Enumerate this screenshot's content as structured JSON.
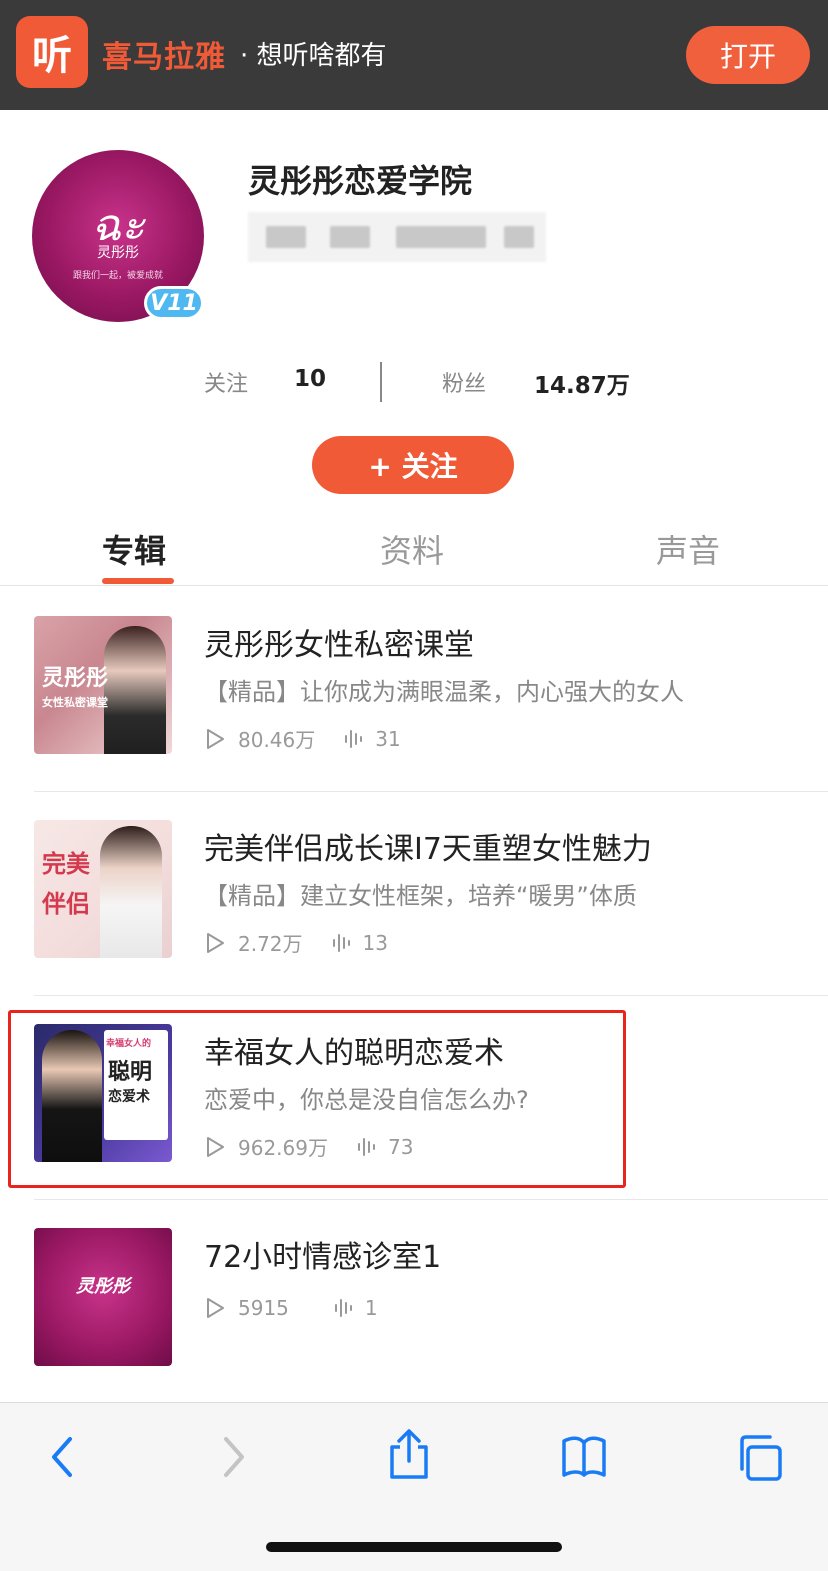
{
  "banner": {
    "app_icon_glyph": "听",
    "brand": "喜马拉雅",
    "slogan": "· 想听啥都有",
    "open_label": "打开"
  },
  "profile": {
    "avatar_logo": "ฉะ",
    "avatar_name": "灵彤彤",
    "avatar_sub": "跟我们一起，被爱成就",
    "level_badge": "V11",
    "name": "灵彤彤恋爱学院",
    "following_label": "关注",
    "following_count": "10",
    "fans_label": "粉丝",
    "fans_count": "14.87万",
    "follow_button": "+ 关注"
  },
  "tabs": [
    {
      "label": "专辑",
      "active": true
    },
    {
      "label": "资料",
      "active": false
    },
    {
      "label": "声音",
      "active": false
    }
  ],
  "albums": [
    {
      "title": "灵彤彤女性私密课堂",
      "subtitle": "【精品】让你成为满眼温柔，内心强大的女人",
      "plays": "80.46万",
      "tracks": "31",
      "thumb_text_1": "灵彤彤",
      "thumb_text_2": "女性私密课堂"
    },
    {
      "title": "完美伴侣成长课I7天重塑女性魅力",
      "subtitle": "【精品】建立女性框架，培养“暖男”体质",
      "plays": "2.72万",
      "tracks": "13",
      "thumb_text_1": "完美",
      "thumb_text_2": "伴侣"
    },
    {
      "title": "幸福女人的聪明恋爱术",
      "subtitle": "恋爱中，你总是没自信怎么办?",
      "plays": "962.69万",
      "tracks": "73",
      "thumb_text_1": "幸福女人的",
      "thumb_text_2": "聪明",
      "thumb_text_3": "恋爱术"
    },
    {
      "title": "72小时情感诊室1",
      "subtitle": "",
      "plays": "5915",
      "tracks": "1",
      "thumb_text_1": "灵彤彤"
    }
  ],
  "colors": {
    "accent": "#f05a37",
    "banner_bg": "#3a3a3a",
    "highlight": "#e8241c",
    "badge": "#4fb8f0"
  },
  "icons": [
    "back-icon",
    "forward-icon",
    "share-icon",
    "bookmarks-icon",
    "tabs-icon",
    "play-icon",
    "track-count-icon"
  ]
}
